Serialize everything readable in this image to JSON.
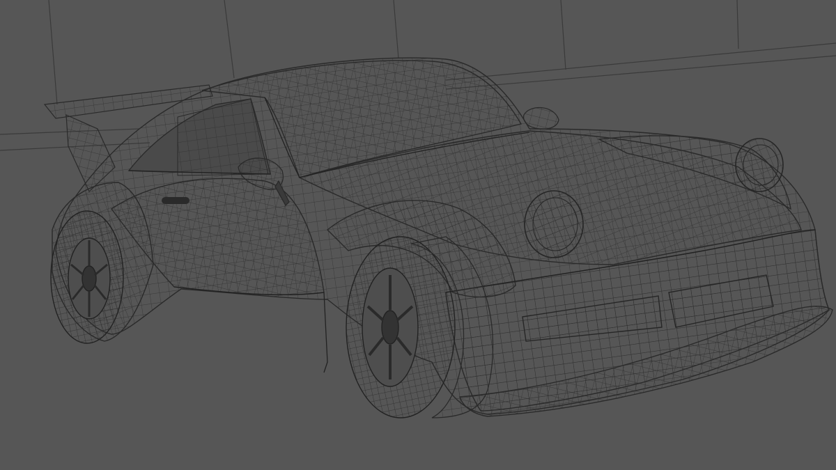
{
  "scene": {
    "subject": "wireframe-car",
    "background_color": "#565656",
    "wire_color": "#2c2c2c",
    "room_line_color": "#3a3a3a"
  }
}
